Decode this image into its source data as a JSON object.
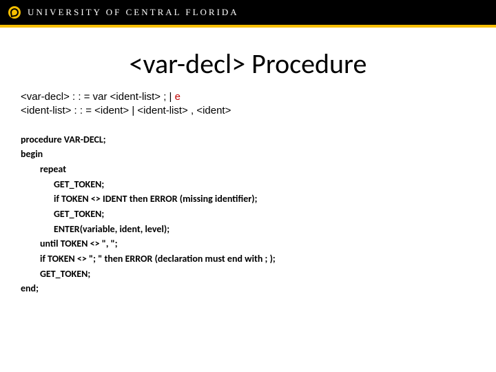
{
  "header": {
    "university": "UNIVERSITY OF CENTRAL FLORIDA",
    "logo_name": "ucf-pegasus-logo"
  },
  "title": "<var-decl> Procedure",
  "grammar": {
    "l1_a": "<var-decl>",
    "l1_b": " : : = var ",
    "l1_c": "<ident-list>",
    "l1_d": " ; | ",
    "l1_e": "e",
    "l2_a": "<ident-list>",
    "l2_b": " : : = ",
    "l2_c": "<ident>",
    "l2_d": " | ",
    "l2_e": "<ident-list>",
    "l2_f": " , ",
    "l2_g": "<ident>"
  },
  "code": {
    "l1": "procedure VAR-DECL;",
    "l2": "begin",
    "l3": "repeat",
    "l4": "GET_TOKEN;",
    "l5": "if TOKEN <> IDENT then ERROR (missing identifier);",
    "l6": "GET_TOKEN;",
    "l7": "ENTER(variable, ident, level);",
    "l8": "until TOKEN <> \", \";",
    "l9": "if TOKEN <> \"; \" then ERROR (declaration must end with ; );",
    "l10": "GET_TOKEN;",
    "l11": "end;"
  }
}
